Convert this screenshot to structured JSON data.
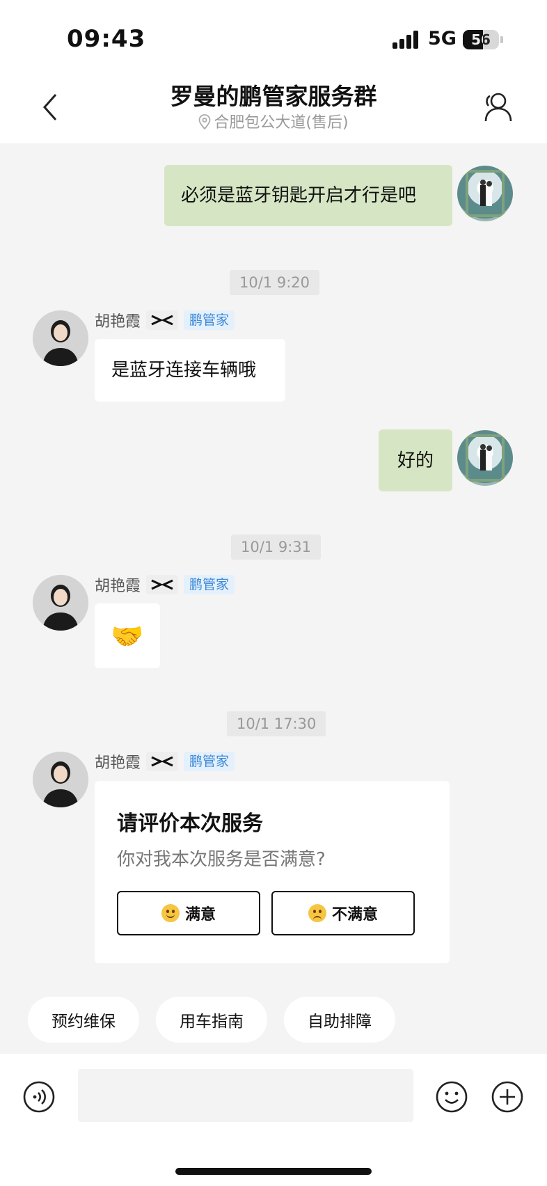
{
  "status": {
    "time": "09:43",
    "network": "5G",
    "battery": "56",
    "battery_level": 0.56
  },
  "header": {
    "title": "罗曼的鹏管家服务群",
    "location": "合肥包公大道(售后)"
  },
  "messages": [
    {
      "text": "必须是蓝牙钥匙开启才行是吧"
    },
    {
      "time": "10/1 9:20"
    },
    {
      "sender": "胡艳霞",
      "tag": "鹏管家",
      "text": "是蓝牙连接车辆哦"
    },
    {
      "text": "好的"
    },
    {
      "time": "10/1 9:31"
    },
    {
      "sender": "胡艳霞",
      "tag": "鹏管家",
      "emoji": "🤝"
    },
    {
      "time": "10/1 17:30"
    },
    {
      "sender": "胡艳霞",
      "tag": "鹏管家"
    }
  ],
  "rating": {
    "title": "请评价本次服务",
    "question": "你对我本次服务是否满意?",
    "good_label": "满意",
    "bad_label": "不满意"
  },
  "quick_actions": [
    "预约维保",
    "用车指南",
    "自助排障"
  ],
  "colors": {
    "self_bubble": "#d6e6c4",
    "tag_bg": "#e4f0fc",
    "tag_text": "#3d8ad6"
  }
}
